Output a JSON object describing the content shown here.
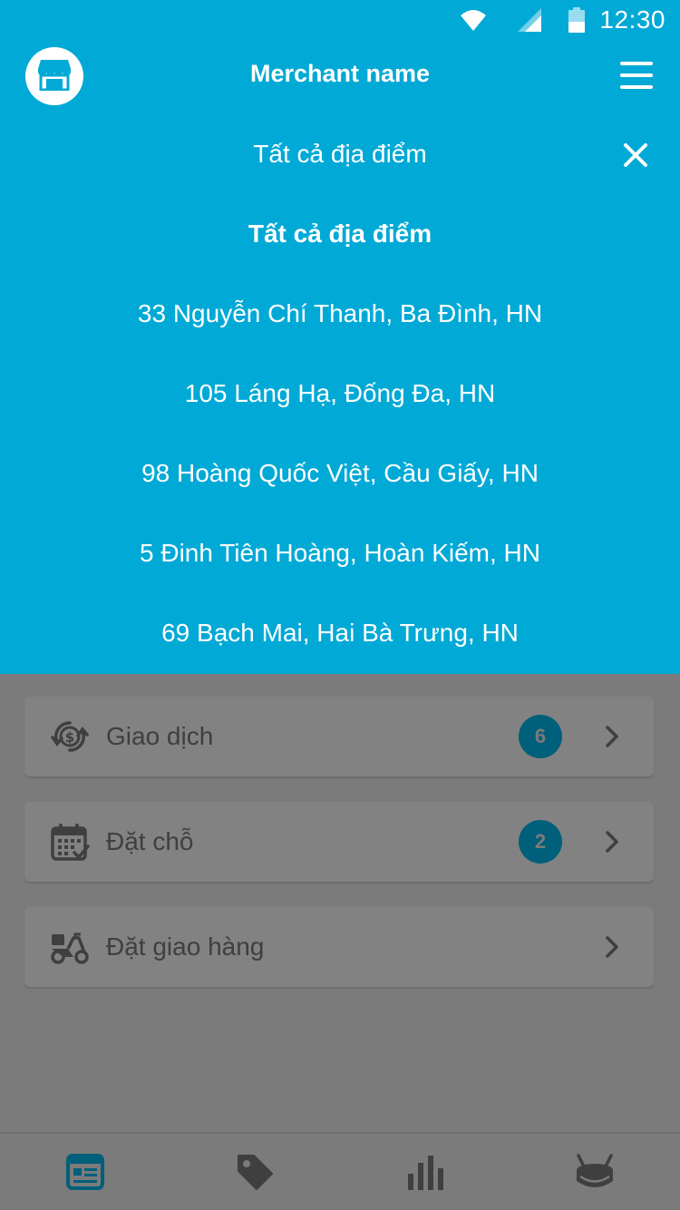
{
  "status_bar": {
    "time": "12:30",
    "icons": [
      "wifi-icon",
      "signal-icon",
      "battery-icon"
    ]
  },
  "header": {
    "title": "Merchant name",
    "left_icon": "store-icon",
    "right_icon": "menu-icon"
  },
  "location_filter": {
    "selected": "Tất cả địa điểm",
    "close_icon": "close-icon",
    "options": [
      {
        "label": "Tất cả địa điểm",
        "active": true
      },
      {
        "label": "33 Nguyễn Chí Thanh, Ba Đình, HN",
        "active": false
      },
      {
        "label": "105 Láng Hạ, Đống Đa, HN",
        "active": false
      },
      {
        "label": "98 Hoàng Quốc Việt, Cầu Giấy, HN",
        "active": false
      },
      {
        "label": "5 Đinh Tiên Hoàng, Hoàn Kiếm, HN",
        "active": false
      },
      {
        "label": "69 Bạch Mai, Hai Bà Trưng, HN",
        "active": false
      }
    ]
  },
  "menu_cards": [
    {
      "label": "Giao dịch",
      "icon": "money-exchange-icon",
      "badge": "6"
    },
    {
      "label": "Đặt chỗ",
      "icon": "calendar-check-icon",
      "badge": "2"
    },
    {
      "label": "Đặt giao hàng",
      "icon": "delivery-scooter-icon",
      "badge": ""
    }
  ],
  "bottom_nav": {
    "tabs": [
      {
        "icon": "newspaper-icon",
        "active": true
      },
      {
        "icon": "tag-icon",
        "active": false
      },
      {
        "icon": "bar-chart-icon",
        "active": false
      },
      {
        "icon": "drum-icon",
        "active": false
      }
    ]
  },
  "colors": {
    "primary": "#00a9d6",
    "overlay": "#7b7b7b",
    "badge": "#005f7a",
    "active_tab": "#005f7a"
  }
}
